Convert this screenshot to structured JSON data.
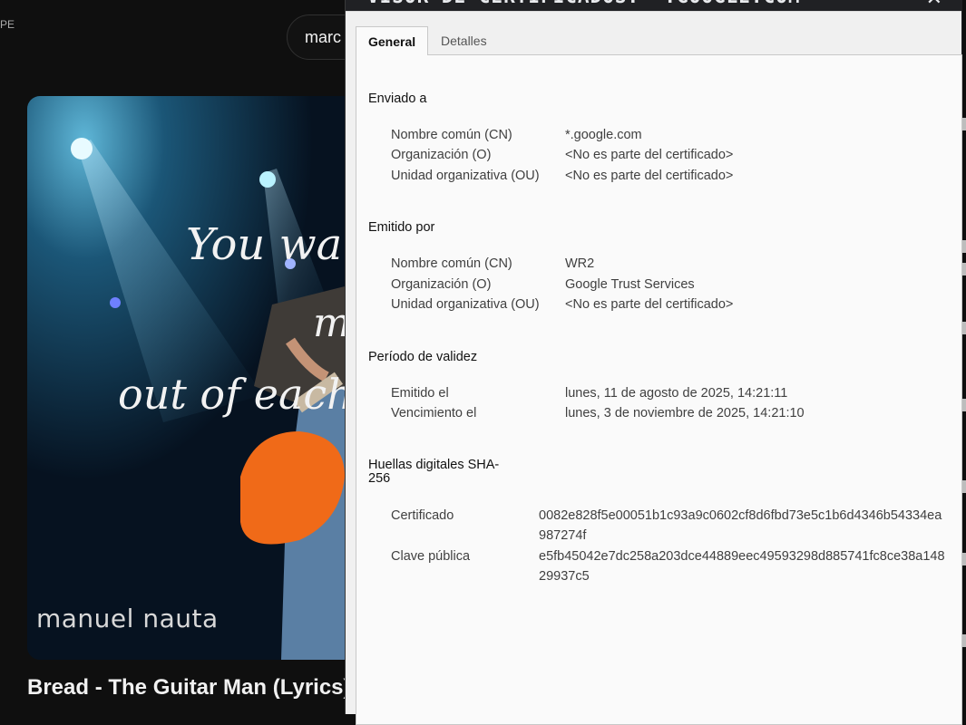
{
  "background": {
    "country_code": "PE",
    "search_query": "marc",
    "thumbnail": {
      "overlay_text_line1": "You wa",
      "overlay_text_line2": "m",
      "overlay_text_line3": "out of each",
      "watermark": "manuel nauta"
    },
    "video_title": "Bread - The Guitar Man (Lyrics)"
  },
  "dialog": {
    "title": "VISOR DE CERTIFICADOS: *.GOOGLE.COM",
    "tabs": [
      {
        "label": "General",
        "active": true
      },
      {
        "label": "Detalles",
        "active": false
      }
    ],
    "issued_to": {
      "heading": "Enviado a",
      "rows": [
        {
          "label": "Nombre común (CN)",
          "value": "*.google.com"
        },
        {
          "label": "Organización (O)",
          "value": "<No es parte del certificado>"
        },
        {
          "label": "Unidad organizativa (OU)",
          "value": "<No es parte del certificado>"
        }
      ]
    },
    "issued_by": {
      "heading": "Emitido por",
      "rows": [
        {
          "label": "Nombre común (CN)",
          "value": "WR2"
        },
        {
          "label": "Organización (O)",
          "value": "Google Trust Services"
        },
        {
          "label": "Unidad organizativa (OU)",
          "value": "<No es parte del certificado>"
        }
      ]
    },
    "validity": {
      "heading": "Período de validez",
      "rows": [
        {
          "label": "Emitido el",
          "value": "lunes, 11 de agosto de 2025, 14:21:11"
        },
        {
          "label": "Vencimiento el",
          "value": "lunes, 3 de noviembre de 2025, 14:21:10"
        }
      ]
    },
    "fingerprints": {
      "heading": "Huellas digitales SHA-256",
      "rows": [
        {
          "label": "Certificado",
          "value": "0082e828f5e00051b1c93a9c0602cf8d6fbd73e5c1b6d4346b54334ea987274f"
        },
        {
          "label": "Clave pública",
          "value": "e5fb45042e7dc258a203dce44889eec49593298d885741fc8ce38a14829937c5"
        }
      ]
    }
  },
  "colors": {
    "page_bg": "#0f0f0f",
    "dialog_bg": "#fafafa",
    "text_label": "#404040",
    "heading": "#111111"
  }
}
